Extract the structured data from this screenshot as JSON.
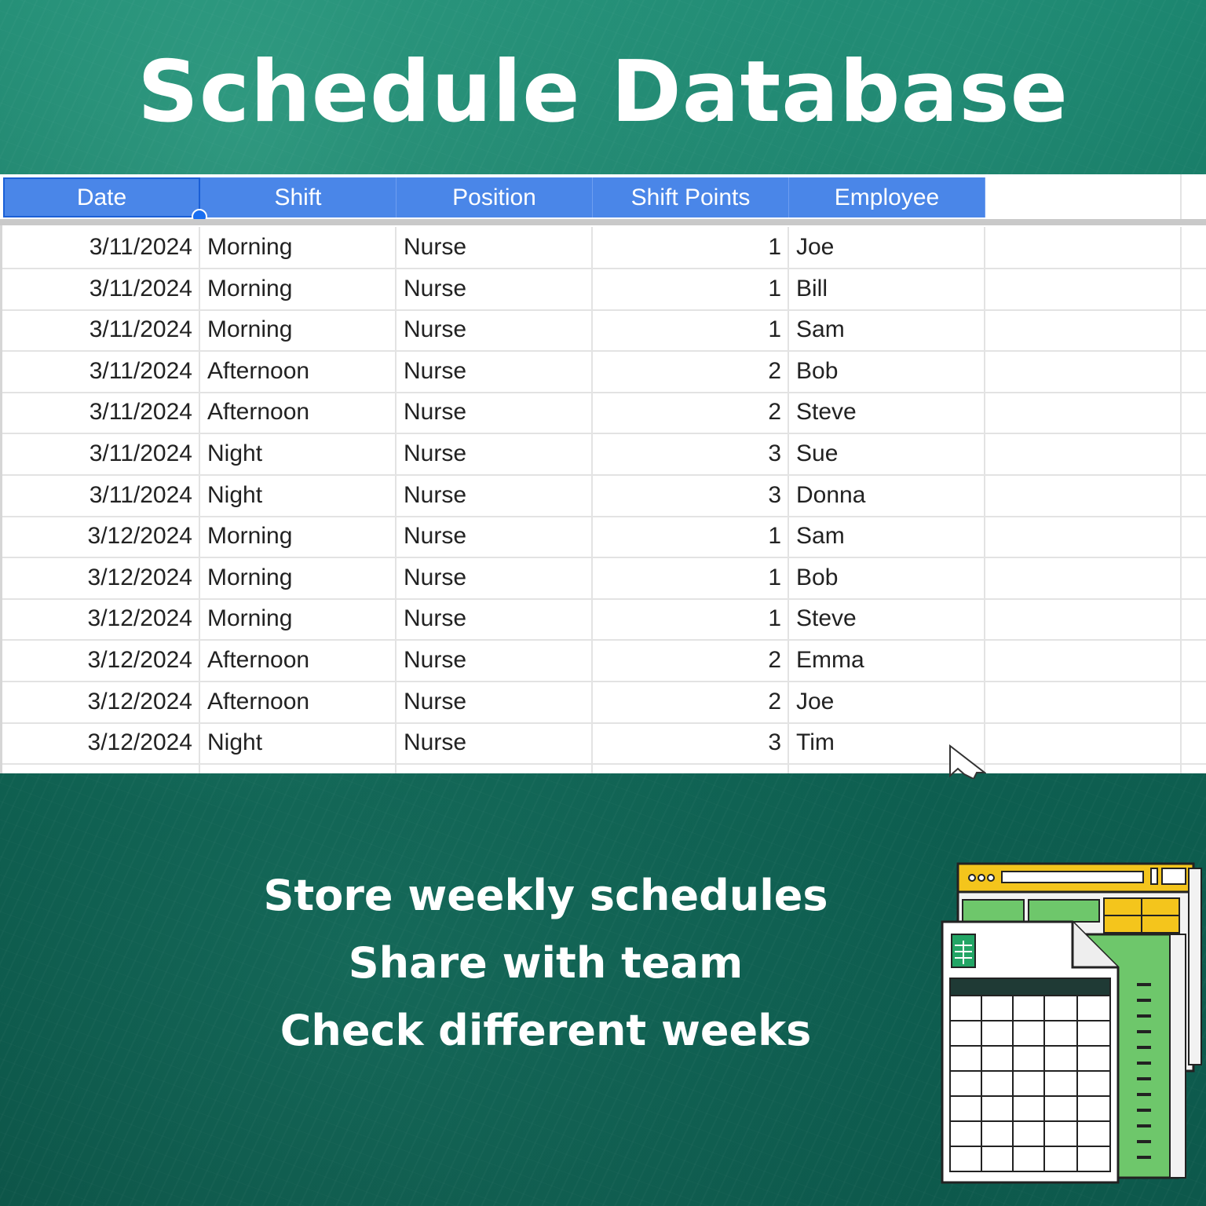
{
  "title": "Schedule Database",
  "columns": [
    "Date",
    "Shift",
    "Position",
    "Shift Points",
    "Employee"
  ],
  "rows": [
    [
      "3/11/2024",
      "Morning",
      "Nurse",
      "1",
      "Joe"
    ],
    [
      "3/11/2024",
      "Morning",
      "Nurse",
      "1",
      "Bill"
    ],
    [
      "3/11/2024",
      "Morning",
      "Nurse",
      "1",
      "Sam"
    ],
    [
      "3/11/2024",
      "Afternoon",
      "Nurse",
      "2",
      "Bob"
    ],
    [
      "3/11/2024",
      "Afternoon",
      "Nurse",
      "2",
      "Steve"
    ],
    [
      "3/11/2024",
      "Night",
      "Nurse",
      "3",
      "Sue"
    ],
    [
      "3/11/2024",
      "Night",
      "Nurse",
      "3",
      "Donna"
    ],
    [
      "3/12/2024",
      "Morning",
      "Nurse",
      "1",
      "Sam"
    ],
    [
      "3/12/2024",
      "Morning",
      "Nurse",
      "1",
      "Bob"
    ],
    [
      "3/12/2024",
      "Morning",
      "Nurse",
      "1",
      "Steve"
    ],
    [
      "3/12/2024",
      "Afternoon",
      "Nurse",
      "2",
      "Emma"
    ],
    [
      "3/12/2024",
      "Afternoon",
      "Nurse",
      "2",
      "Joe"
    ],
    [
      "3/12/2024",
      "Night",
      "Nurse",
      "3",
      "Tim"
    ]
  ],
  "features": [
    "Store weekly schedules",
    "Share with team",
    "Check different weeks"
  ],
  "colors": {
    "header_fill": "#4a86e8",
    "header_text": "#ffffff",
    "background": "#0e5c4d",
    "title_text": "#ffffff"
  },
  "icons": [
    "spreadsheet-files-icon",
    "mouse-cursor-icon"
  ]
}
